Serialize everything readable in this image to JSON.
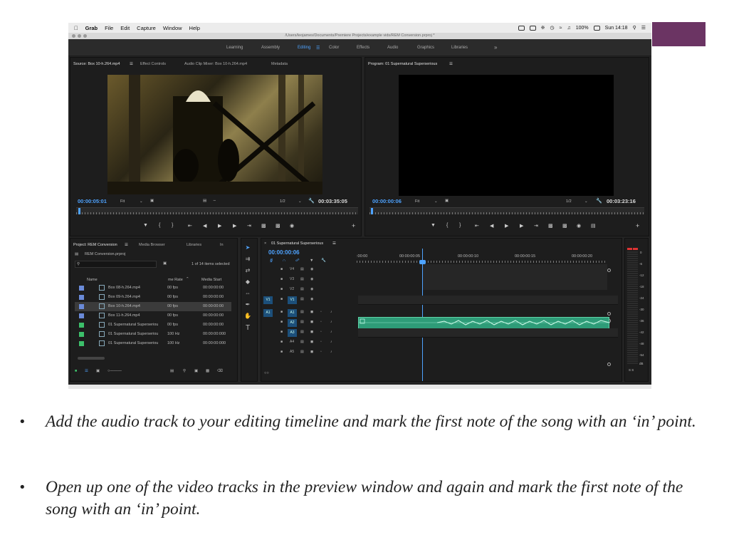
{
  "mac": {
    "app": "Grab",
    "menus": [
      "File",
      "Edit",
      "Capture",
      "Window",
      "Help"
    ],
    "battery": "100%",
    "clock": "Sun 14:18",
    "path": "/Users/leojames/Documents/Premiere Projects/example vids/REM Conversion.prproj *"
  },
  "workspaces": [
    "Learning",
    "Assembly",
    "Editing",
    "Color",
    "Effects",
    "Audio",
    "Graphics",
    "Libraries"
  ],
  "active_workspace": "Editing",
  "source": {
    "tabs": [
      "Source: Box 10-h.264.mp4",
      "Effect Controls",
      "Audio Clip Mixer: Box 10-h.264.mp4",
      "Metadata"
    ],
    "timecode": "00:00:05:01",
    "fit": "Fit",
    "res": "1/2",
    "duration": "00:03:35:05"
  },
  "program": {
    "tab": "Program: 01 Supernatural Superserious",
    "timecode": "00:00:00:06",
    "fit": "Fit",
    "res": "1/2",
    "duration": "00:03:23:16"
  },
  "project": {
    "tabs": [
      "Project: REM Conversion",
      "Media Browser",
      "Libraries",
      "In"
    ],
    "file": "REM Conversion.prproj",
    "count": "1 of 14 items selected",
    "col_name": "Name",
    "col_rate": "me Rate",
    "col_start": "Media Start",
    "rows": [
      {
        "name": "Box 08-h.264.mp4",
        "rate": "00 fps",
        "start": "00:00:00:00",
        "color": "#6a8ad8"
      },
      {
        "name": "Box 09-h.264.mp4",
        "rate": "00 fps",
        "start": "00:00:00:00",
        "color": "#6a8ad8"
      },
      {
        "name": "Box 10-h.264.mp4",
        "rate": "00 fps",
        "start": "00:00:00:00",
        "color": "#6a8ad8"
      },
      {
        "name": "Box 11-h.264.mp4",
        "rate": "00 fps",
        "start": "00:00:00:00",
        "color": "#6a8ad8"
      },
      {
        "name": "01 Supernatural Superseriou",
        "rate": "00 fps",
        "start": "00:00:00:00",
        "color": "#3cbf6a"
      },
      {
        "name": "01 Supernatural Superseriou",
        "rate": "100 Hz",
        "start": "00:00:00:000",
        "color": "#3cbf6a"
      },
      {
        "name": "01 Supernatural Superseriou",
        "rate": "100 Hz",
        "start": "00:00:00:000",
        "color": "#3cbf6a"
      }
    ]
  },
  "timeline": {
    "tab": "01 Supernatural Superserious",
    "timecode": "00:00:00:06",
    "ruler": [
      ":00:00",
      "00:00:00:05",
      "00:00:00:10",
      "00:00:00:15",
      "00:00:00:20"
    ],
    "video_tracks": [
      "V4",
      "V3",
      "V2",
      "V1"
    ],
    "audio_tracks": [
      "A1",
      "A2",
      "A3",
      "A4",
      "A5"
    ],
    "source_v": "V1",
    "source_a": "A1"
  },
  "meter": [
    "0",
    "-6",
    "-12",
    "-18",
    "-24",
    "-30",
    "-36",
    "-42",
    "-48",
    "-54",
    "dB"
  ],
  "meter_footer": "S S",
  "bullets": [
    "Add the audio track to your editing timeline and mark the first note of the song with an ‘in’ point.",
    "Open up one of the video tracks in the preview window and again and mark the first note of the song with an ‘in’ point."
  ],
  "bullet_symbol": "•",
  "colors": {
    "accent": "#6b3463",
    "timecode": "#4ea3ff",
    "audio_clip": "#2e9c78"
  }
}
